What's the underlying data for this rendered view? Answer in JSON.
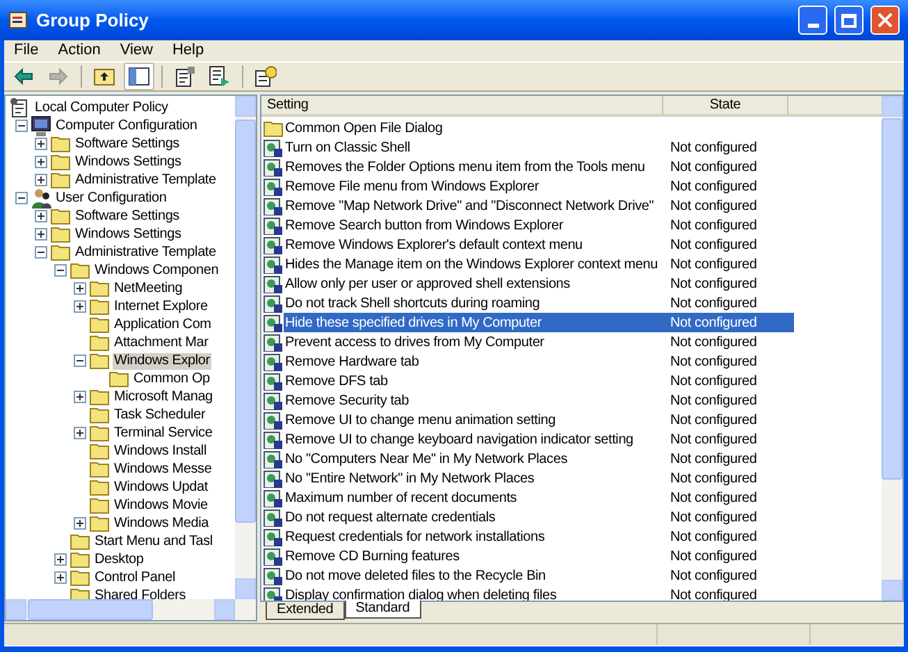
{
  "window": {
    "title": "Group Policy"
  },
  "menu": [
    "File",
    "Action",
    "View",
    "Help"
  ],
  "toolbar": [
    {
      "kind": "back",
      "disabled": false
    },
    {
      "kind": "forward",
      "disabled": true
    },
    {
      "kind": "up",
      "disabled": false
    },
    {
      "kind": "tree",
      "disabled": false
    },
    {
      "kind": "properties",
      "disabled": false
    },
    {
      "kind": "export",
      "disabled": false
    },
    {
      "kind": "help",
      "disabled": false
    }
  ],
  "tree": [
    {
      "label": "Local Computer Policy",
      "kind": "policy",
      "selected": false,
      "children": [
        {
          "label": "Computer Configuration",
          "kind": "computer",
          "selected": false,
          "expanded": true,
          "children": [
            {
              "label": "Software Settings",
              "kind": "folder",
              "selected": false,
              "expanded": false
            },
            {
              "label": "Windows Settings",
              "kind": "folder",
              "selected": false,
              "expanded": false
            },
            {
              "label": "Administrative Template",
              "kind": "folder",
              "selected": false,
              "expanded": false
            }
          ]
        },
        {
          "label": "User Configuration",
          "kind": "user",
          "selected": false,
          "expanded": true,
          "children": [
            {
              "label": "Software Settings",
              "kind": "folder",
              "selected": false,
              "expanded": false
            },
            {
              "label": "Windows Settings",
              "kind": "folder",
              "selected": false,
              "expanded": false
            },
            {
              "label": "Administrative Template",
              "kind": "folder",
              "selected": false,
              "expanded": true,
              "children": [
                {
                  "label": "Windows Componen",
                  "kind": "folder",
                  "selected": false,
                  "expanded": true,
                  "children": [
                    {
                      "label": "NetMeeting",
                      "kind": "folder",
                      "selected": false,
                      "expanded": false
                    },
                    {
                      "label": "Internet Explore",
                      "kind": "folder",
                      "selected": false,
                      "expanded": false
                    },
                    {
                      "label": "Application Com",
                      "kind": "folder",
                      "selected": false
                    },
                    {
                      "label": "Attachment Mar",
                      "kind": "folder",
                      "selected": false
                    },
                    {
                      "label": "Windows Explor",
                      "kind": "folder",
                      "selected": true,
                      "expanded": true,
                      "children": [
                        {
                          "label": "Common Op",
                          "kind": "folder",
                          "selected": false
                        }
                      ]
                    },
                    {
                      "label": "Microsoft Manag",
                      "kind": "folder",
                      "selected": false,
                      "expanded": false
                    },
                    {
                      "label": "Task Scheduler",
                      "kind": "folder",
                      "selected": false
                    },
                    {
                      "label": "Terminal Service",
                      "kind": "folder",
                      "selected": false,
                      "expanded": false
                    },
                    {
                      "label": "Windows Install",
                      "kind": "folder",
                      "selected": false
                    },
                    {
                      "label": "Windows Messe",
                      "kind": "folder",
                      "selected": false
                    },
                    {
                      "label": "Windows Updat",
                      "kind": "folder",
                      "selected": false
                    },
                    {
                      "label": "Windows Movie",
                      "kind": "folder",
                      "selected": false
                    },
                    {
                      "label": "Windows Media",
                      "kind": "folder",
                      "selected": false,
                      "expanded": false
                    }
                  ]
                },
                {
                  "label": "Start Menu and Tasl",
                  "kind": "folder",
                  "selected": false
                },
                {
                  "label": "Desktop",
                  "kind": "folder",
                  "selected": false,
                  "expanded": false
                },
                {
                  "label": "Control Panel",
                  "kind": "folder",
                  "selected": false,
                  "expanded": false
                },
                {
                  "label": "Shared Folders",
                  "kind": "folder",
                  "selected": false
                }
              ]
            }
          ]
        }
      ]
    }
  ],
  "list": {
    "columns": [
      "Setting",
      "State"
    ],
    "rows": [
      {
        "kind": "folder",
        "setting": "Common Open File Dialog",
        "selected": false
      },
      {
        "kind": "policy",
        "setting": "Turn on Classic Shell",
        "state": "Not configured",
        "selected": false
      },
      {
        "kind": "policy",
        "setting": "Removes the Folder Options menu item from the Tools menu",
        "state": "Not configured",
        "selected": false
      },
      {
        "kind": "policy",
        "setting": "Remove File menu from Windows Explorer",
        "state": "Not configured",
        "selected": false
      },
      {
        "kind": "policy",
        "setting": "Remove \"Map Network Drive\" and \"Disconnect Network Drive\"",
        "state": "Not configured",
        "selected": false
      },
      {
        "kind": "policy",
        "setting": "Remove Search button from Windows Explorer",
        "state": "Not configured",
        "selected": false
      },
      {
        "kind": "policy",
        "setting": "Remove Windows Explorer's default context menu",
        "state": "Not configured",
        "selected": false
      },
      {
        "kind": "policy",
        "setting": "Hides the Manage item on the Windows Explorer context menu",
        "state": "Not configured",
        "selected": false
      },
      {
        "kind": "policy",
        "setting": "Allow only per user or approved shell extensions",
        "state": "Not configured",
        "selected": false
      },
      {
        "kind": "policy",
        "setting": "Do not track Shell shortcuts during roaming",
        "state": "Not configured",
        "selected": false
      },
      {
        "kind": "policy",
        "setting": "Hide these specified drives in My Computer",
        "state": "Not configured",
        "selected": true
      },
      {
        "kind": "policy",
        "setting": "Prevent access to drives from My Computer",
        "state": "Not configured",
        "selected": false
      },
      {
        "kind": "policy",
        "setting": "Remove Hardware tab",
        "state": "Not configured",
        "selected": false
      },
      {
        "kind": "policy",
        "setting": "Remove DFS tab",
        "state": "Not configured",
        "selected": false
      },
      {
        "kind": "policy",
        "setting": "Remove Security tab",
        "state": "Not configured",
        "selected": false
      },
      {
        "kind": "policy",
        "setting": "Remove UI to change menu animation setting",
        "state": "Not configured",
        "selected": false
      },
      {
        "kind": "policy",
        "setting": "Remove UI to change keyboard navigation indicator setting",
        "state": "Not configured",
        "selected": false
      },
      {
        "kind": "policy",
        "setting": "No \"Computers Near Me\" in My Network Places",
        "state": "Not configured",
        "selected": false
      },
      {
        "kind": "policy",
        "setting": "No \"Entire Network\" in My Network Places",
        "state": "Not configured",
        "selected": false
      },
      {
        "kind": "policy",
        "setting": "Maximum number of recent documents",
        "state": "Not configured",
        "selected": false
      },
      {
        "kind": "policy",
        "setting": "Do not request alternate credentials",
        "state": "Not configured",
        "selected": false
      },
      {
        "kind": "policy",
        "setting": "Request credentials for network installations",
        "state": "Not configured",
        "selected": false
      },
      {
        "kind": "policy",
        "setting": "Remove CD Burning features",
        "state": "Not configured",
        "selected": false
      },
      {
        "kind": "policy",
        "setting": "Do not move deleted files to the Recycle Bin",
        "state": "Not configured",
        "selected": false
      },
      {
        "kind": "policy",
        "setting": "Display confirmation dialog when deleting files",
        "state": "Not configured",
        "selected": false
      }
    ]
  },
  "tabs": [
    {
      "label": "Extended",
      "selected": false
    },
    {
      "label": "Standard",
      "selected": true
    }
  ]
}
